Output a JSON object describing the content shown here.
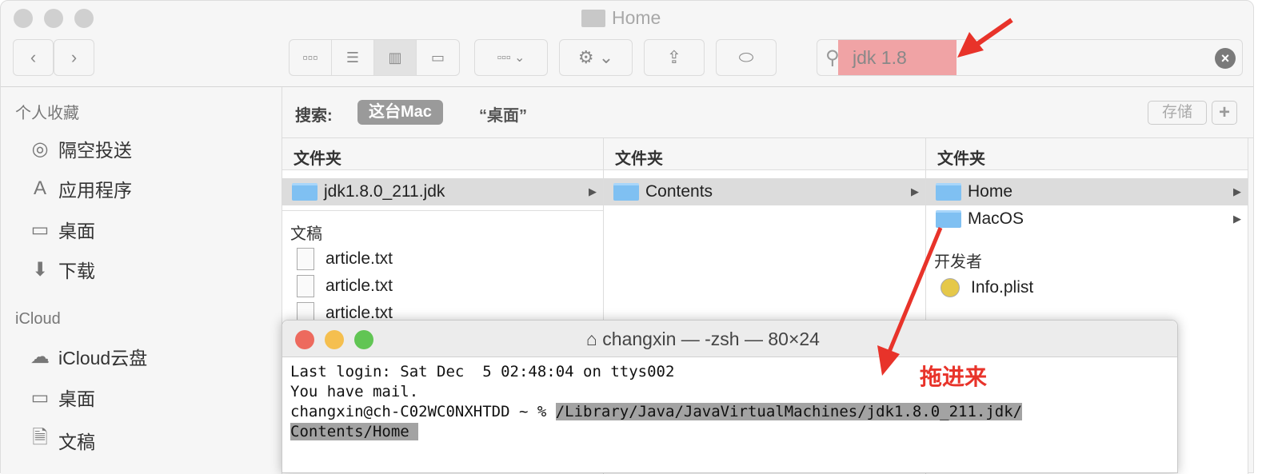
{
  "finder": {
    "title": "Home",
    "toolbar": {
      "back": "‹",
      "forward": "›",
      "view_icons": [
        "icon-view",
        "list-view",
        "column-view",
        "gallery-view"
      ],
      "group": "group-icon",
      "action": "gear-icon",
      "share": "share-icon",
      "tag": "tag-icon"
    },
    "search": {
      "value": "jdk 1.8"
    },
    "sidebar": {
      "favorites_header": "个人收藏",
      "favorites": [
        {
          "label": "隔空投送",
          "icon": "airdrop-icon"
        },
        {
          "label": "应用程序",
          "icon": "applications-icon"
        },
        {
          "label": "桌面",
          "icon": "desktop-icon"
        },
        {
          "label": "下载",
          "icon": "download-icon"
        }
      ],
      "icloud_header": "iCloud",
      "icloud": [
        {
          "label": "iCloud云盘",
          "icon": "cloud-icon"
        },
        {
          "label": "桌面",
          "icon": "desktop-icon"
        },
        {
          "label": "文稿",
          "icon": "document-icon"
        }
      ]
    },
    "scope": {
      "label": "搜索:",
      "this_mac": "这台Mac",
      "desktop": "“桌面”",
      "save": "存储",
      "add": "+"
    },
    "columns": [
      {
        "header": "文件夹",
        "items": [
          "jdk1.8.0_211.jdk"
        ],
        "section": "文稿",
        "files": [
          "article.txt",
          "article.txt",
          "article.txt"
        ]
      },
      {
        "header": "文件夹",
        "items": [
          "Contents"
        ]
      },
      {
        "header": "文件夹",
        "items": [
          "Home",
          "MacOS"
        ],
        "section": "开发者",
        "files": [
          "Info.plist"
        ]
      }
    ]
  },
  "terminal": {
    "title": "changxin — -zsh — 80×24",
    "lines": [
      "Last login: Sat Dec  5 02:48:04 on ttys002",
      "You have mail."
    ],
    "prompt": "changxin@ch-C02WC0NXHTDD ~ % ",
    "path1": "/Library/Java/JavaVirtualMachines/jdk1.8.0_211.jdk/",
    "path2": "Contents/Home "
  },
  "annotation": {
    "text": "拖进来",
    "color": "#e8332a"
  }
}
